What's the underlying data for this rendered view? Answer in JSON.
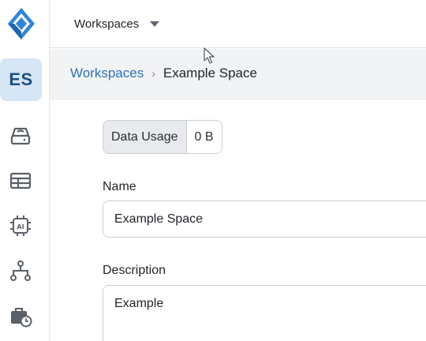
{
  "sidebar": {
    "workspace_initials": "ES",
    "nav": [
      {
        "icon": "storage-drive-icon"
      },
      {
        "icon": "table-icon"
      },
      {
        "icon": "ai-chip-icon"
      },
      {
        "icon": "workflow-hierarchy-icon"
      },
      {
        "icon": "briefcase-clock-icon"
      }
    ]
  },
  "topbar": {
    "workspace_selector_label": "Workspaces"
  },
  "breadcrumb": {
    "parent": "Workspaces",
    "separator": "›",
    "current": "Example Space"
  },
  "data_usage": {
    "label": "Data Usage",
    "value": "0 B"
  },
  "form": {
    "name_label": "Name",
    "name_value": "Example Space",
    "description_label": "Description",
    "description_value": "Example"
  },
  "colors": {
    "accent": "#2b74b8",
    "logo_blue": "#2f86d6",
    "workspace_badge_bg": "#d7e6f6",
    "breadcrumb_bg": "#f2f3f5"
  }
}
